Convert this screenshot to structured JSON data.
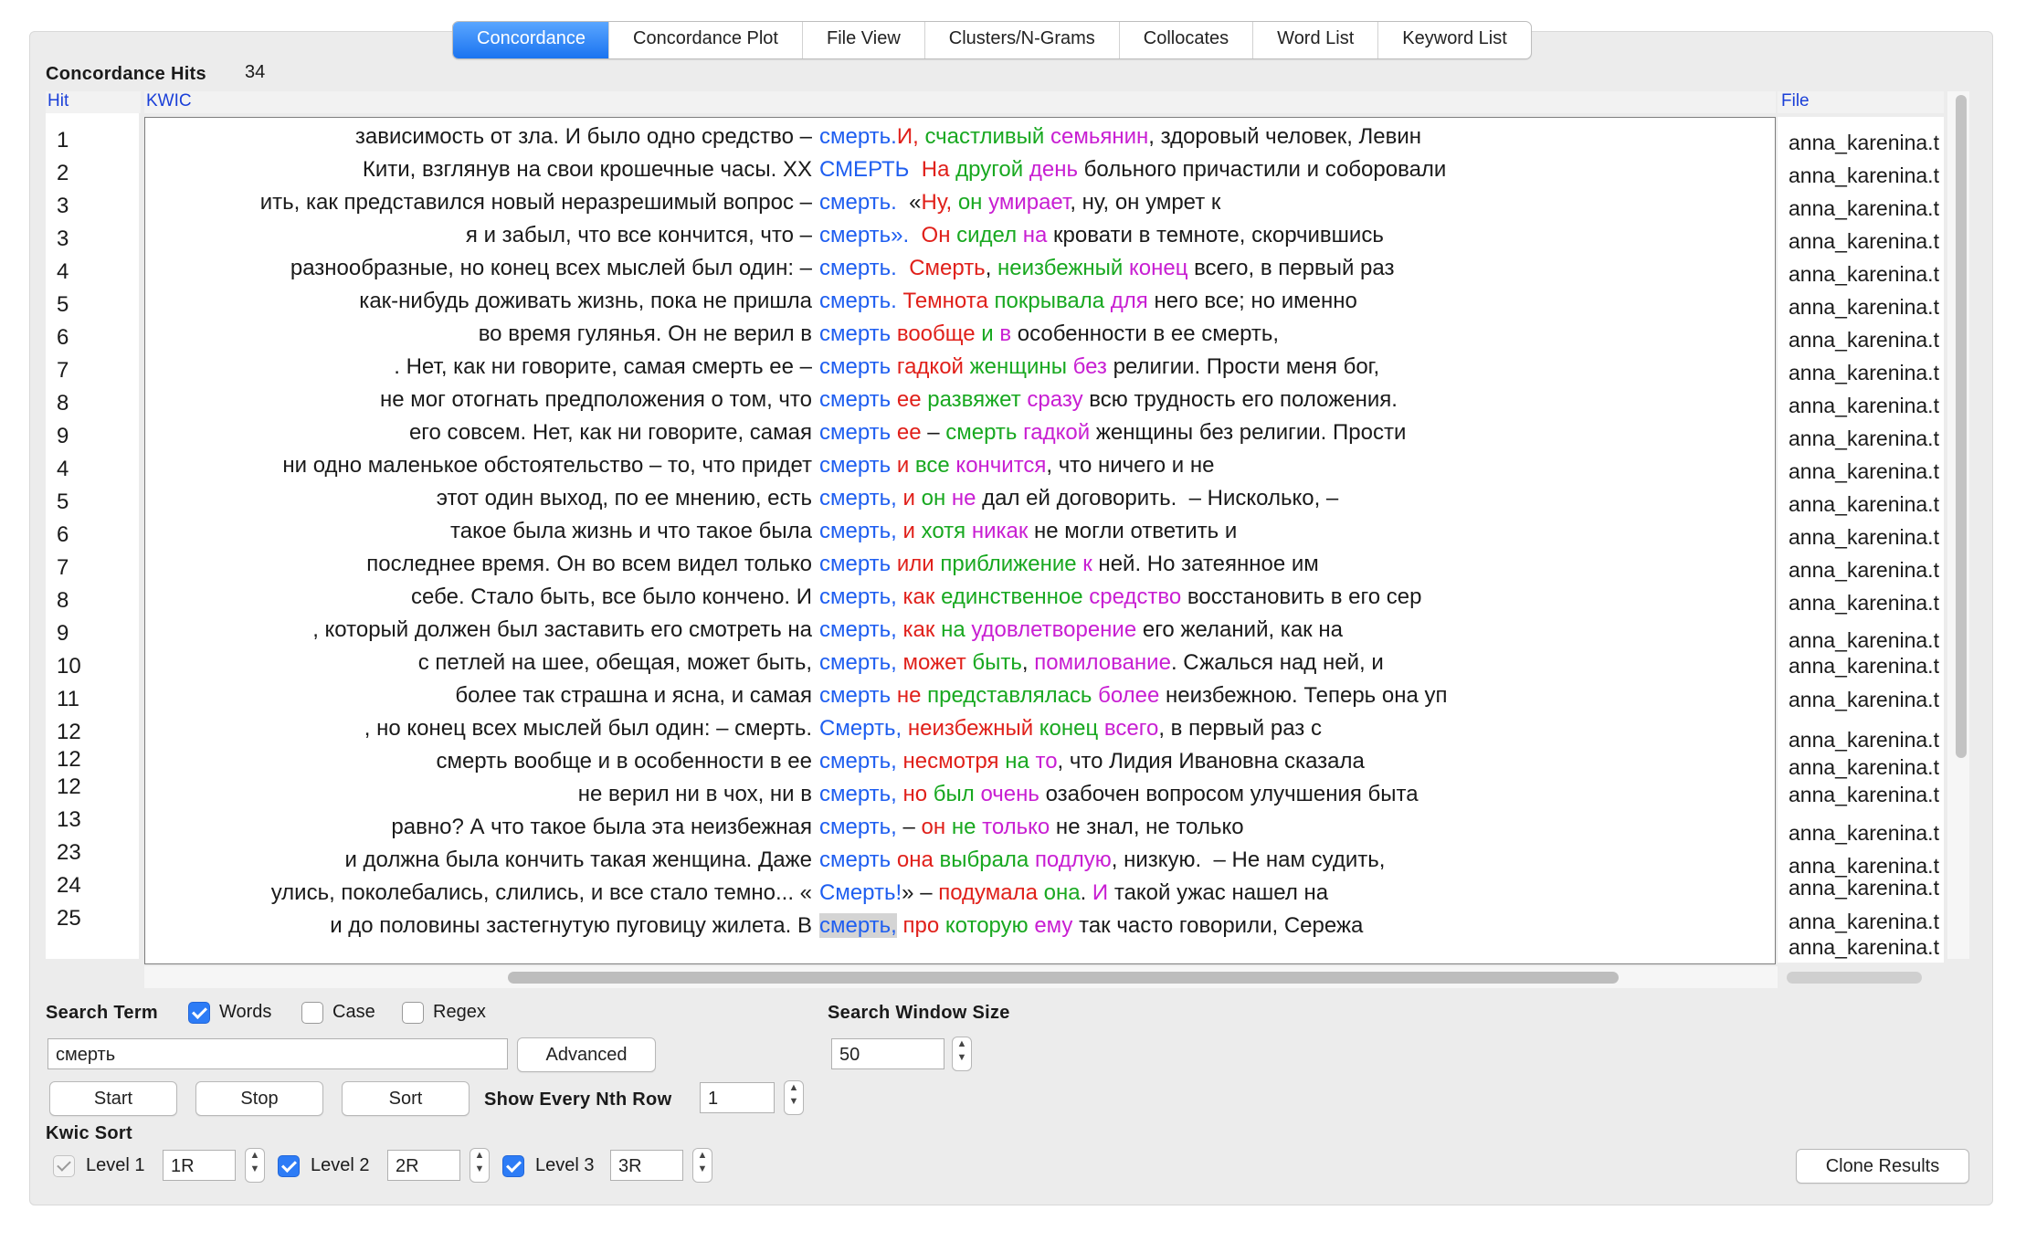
{
  "tabs": [
    {
      "label": "Concordance",
      "active": true
    },
    {
      "label": "Concordance Plot"
    },
    {
      "label": "File View"
    },
    {
      "label": "Clusters/N-Grams"
    },
    {
      "label": "Collocates"
    },
    {
      "label": "Word List"
    },
    {
      "label": "Keyword List"
    }
  ],
  "hits": {
    "label": "Concordance Hits",
    "count": "34"
  },
  "columns": {
    "hit": "Hit",
    "kwic": "KWIC",
    "file": "File"
  },
  "colors": {
    "keyword": "#1e5ef0",
    "sort_level_1": "#e0201a",
    "sort_level_2": "#18a820",
    "sort_level_3": "#c81ed2",
    "tab_active": "#1a73f0"
  },
  "rows": [
    {
      "hit": "1",
      "left": "зависимость от зла. И было одно средство –",
      "kw": "смерть.",
      "right": [
        [
          "И,",
          "c1"
        ],
        [
          " "
        ],
        [
          "счастливый",
          "c2"
        ],
        [
          " "
        ],
        [
          "семьянин",
          "c3"
        ],
        [
          ", здоровый человек, Левин"
        ]
      ],
      "file": "anna_karenina.t"
    },
    {
      "hit": "2",
      "left": "Кити, взглянув на свои крошечные часы.       XX",
      "kw": "СМЕРТЬ",
      "right": [
        [
          "  "
        ],
        [
          "На",
          "c1"
        ],
        [
          " "
        ],
        [
          "другой",
          "c2"
        ],
        [
          " "
        ],
        [
          "день",
          "c3"
        ],
        [
          " больного причастили и соборовали"
        ]
      ],
      "file": "anna_karenina.t"
    },
    {
      "hit": "3",
      "left": "ить, как представился новый неразрешимый вопрос –",
      "kw": "смерть.",
      "right": [
        [
          "  «"
        ],
        [
          "Ну,",
          "c1"
        ],
        [
          " "
        ],
        [
          "он",
          "c2"
        ],
        [
          " "
        ],
        [
          "умирает",
          "c3"
        ],
        [
          ", ну, он умрет к"
        ]
      ],
      "file": "anna_karenina.t"
    },
    {
      "hit": "3",
      "left": "я и забыл, что все кончится, что –",
      "kw": "смерть».",
      "right": [
        [
          "  "
        ],
        [
          "Он",
          "c1"
        ],
        [
          " "
        ],
        [
          "сидел",
          "c2"
        ],
        [
          " "
        ],
        [
          "на",
          "c3"
        ],
        [
          " кровати в темноте, скорчившись"
        ]
      ],
      "file": "anna_karenina.t"
    },
    {
      "hit": "4",
      "left": "разнообразные, но конец всех мыслей был один: –",
      "kw": "смерть.",
      "right": [
        [
          "  "
        ],
        [
          "Смерть",
          "c1"
        ],
        [
          ", "
        ],
        [
          "неизбежный",
          "c2"
        ],
        [
          " "
        ],
        [
          "конец",
          "c3"
        ],
        [
          " всего, в первый раз"
        ]
      ],
      "file": "anna_karenina.t"
    },
    {
      "hit": "5",
      "left": "как-нибудь доживать жизнь, пока не пришла",
      "kw": "смерть.",
      "right": [
        [
          " "
        ],
        [
          "Темнота",
          "c1"
        ],
        [
          " "
        ],
        [
          "покрывала",
          "c2"
        ],
        [
          " "
        ],
        [
          "для",
          "c3"
        ],
        [
          " него все; но именно"
        ]
      ],
      "file": "anna_karenina.t"
    },
    {
      "hit": "6",
      "left": "во время гулянья. Он не верил в",
      "kw": "смерть",
      "right": [
        [
          " "
        ],
        [
          "вообще",
          "c1"
        ],
        [
          " "
        ],
        [
          "и",
          "c2"
        ],
        [
          " "
        ],
        [
          "в",
          "c3"
        ],
        [
          " особенности в ее смерть,"
        ]
      ],
      "file": "anna_karenina.t"
    },
    {
      "hit": "7",
      "left": ". Нет, как ни говорите, самая смерть ее –",
      "kw": "смерть",
      "right": [
        [
          " "
        ],
        [
          "гадкой",
          "c1"
        ],
        [
          " "
        ],
        [
          "женщины",
          "c2"
        ],
        [
          " "
        ],
        [
          "без",
          "c3"
        ],
        [
          " религии. Прости меня бог,"
        ]
      ],
      "file": "anna_karenina.t"
    },
    {
      "hit": "8",
      "left": "не мог отогнать предположения о том, что",
      "kw": "смерть",
      "right": [
        [
          " "
        ],
        [
          "ее",
          "c1"
        ],
        [
          " "
        ],
        [
          "развяжет",
          "c2"
        ],
        [
          " "
        ],
        [
          "сразу",
          "c3"
        ],
        [
          " всю трудность его положения."
        ]
      ],
      "file": "anna_karenina.t"
    },
    {
      "hit": "9",
      "left": "его совсем. Нет, как ни говорите, самая",
      "kw": "смерть",
      "right": [
        [
          " "
        ],
        [
          "ее",
          "c1"
        ],
        [
          " – "
        ],
        [
          "смерть",
          "c2"
        ],
        [
          " "
        ],
        [
          "гадкой",
          "c3"
        ],
        [
          " женщины без религии. Прости"
        ]
      ],
      "file": "anna_karenina.t"
    },
    {
      "hit": "4",
      "left": "ни одно маленькое обстоятельство – то, что придет",
      "kw": "смерть",
      "right": [
        [
          " "
        ],
        [
          "и",
          "c1"
        ],
        [
          " "
        ],
        [
          "все",
          "c2"
        ],
        [
          " "
        ],
        [
          "кончится",
          "c3"
        ],
        [
          ", что ничего и не"
        ]
      ],
      "file": "anna_karenina.t"
    },
    {
      "hit": "5",
      "left": "этот один выход, по ее мнению, есть",
      "kw": "смерть,",
      "right": [
        [
          " "
        ],
        [
          "и",
          "c1"
        ],
        [
          " "
        ],
        [
          "он",
          "c2"
        ],
        [
          " "
        ],
        [
          "не",
          "c3"
        ],
        [
          " дал ей договорить.  – Нисколько, –"
        ]
      ],
      "file": "anna_karenina.t"
    },
    {
      "hit": "6",
      "left": "такое была жизнь и что такое была",
      "kw": "смерть,",
      "right": [
        [
          " "
        ],
        [
          "и",
          "c1"
        ],
        [
          " "
        ],
        [
          "хотя",
          "c2"
        ],
        [
          " "
        ],
        [
          "никак",
          "c3"
        ],
        [
          " не могли ответить и"
        ]
      ],
      "file": "anna_karenina.t"
    },
    {
      "hit": "7",
      "left": "последнее время. Он во всем видел только",
      "kw": "смерть",
      "right": [
        [
          " "
        ],
        [
          "или",
          "c1"
        ],
        [
          " "
        ],
        [
          "приближение",
          "c2"
        ],
        [
          " "
        ],
        [
          "к",
          "c3"
        ],
        [
          " ней. Но затеянное им"
        ]
      ],
      "file": "anna_karenina.t"
    },
    {
      "hit": "8",
      "left": "себе. Стало быть, все было кончено.  И",
      "kw": "смерть,",
      "right": [
        [
          " "
        ],
        [
          "как",
          "c1"
        ],
        [
          " "
        ],
        [
          "единственное",
          "c2"
        ],
        [
          " "
        ],
        [
          "средство",
          "c3"
        ],
        [
          " восстановить в его сер"
        ]
      ],
      "file": "anna_karenina.t"
    },
    {
      "hit": "9",
      "left": ", который должен был заставить его смотреть на",
      "kw": "смерть,",
      "right": [
        [
          " "
        ],
        [
          "как",
          "c1"
        ],
        [
          " "
        ],
        [
          "на",
          "c2"
        ],
        [
          " "
        ],
        [
          "удовлетворение",
          "c3"
        ],
        [
          " его желаний, как на"
        ]
      ],
      "file": "anna_karenina.t"
    },
    {
      "hit": "10",
      "left": "с петлей на шее, обещая, может быть,",
      "kw": "смерть,",
      "right": [
        [
          " "
        ],
        [
          "может",
          "c1"
        ],
        [
          " "
        ],
        [
          "быть",
          "c2"
        ],
        [
          ", "
        ],
        [
          "помилование",
          "c3"
        ],
        [
          ". Сжалься над ней, и"
        ]
      ],
      "file": "anna_karenina.t"
    },
    {
      "hit": "11",
      "left": "более так страшна и ясна, и самая",
      "kw": "смерть",
      "right": [
        [
          " "
        ],
        [
          "не",
          "c1"
        ],
        [
          " "
        ],
        [
          "представлялась",
          "c2"
        ],
        [
          " "
        ],
        [
          "более",
          "c3"
        ],
        [
          " неизбежною. Теперь она уп"
        ]
      ],
      "file": "anna_karenina.t"
    },
    {
      "hit": "12",
      "left": ", но конец всех мыслей был один: – смерть.",
      "kw": "Смерть,",
      "right": [
        [
          " "
        ],
        [
          "неизбежный",
          "c1"
        ],
        [
          " "
        ],
        [
          "конец",
          "c2"
        ],
        [
          " "
        ],
        [
          "всего",
          "c3"
        ],
        [
          ", в первый раз с"
        ]
      ],
      "file": "anna_karenina.t"
    },
    {
      "hit": "12",
      "left": "смерть вообще и в особенности в ее",
      "kw": "смерть,",
      "right": [
        [
          " "
        ],
        [
          "несмотря",
          "c1"
        ],
        [
          " "
        ],
        [
          "на",
          "c2"
        ],
        [
          " "
        ],
        [
          "то",
          "c3"
        ],
        [
          ", что Лидия Ивановна сказала"
        ]
      ],
      "file": "anna_karenina.t"
    },
    {
      "hit": "12",
      "left": "не верил ни в чох, ни в",
      "kw": "смерть,",
      "right": [
        [
          " "
        ],
        [
          "но",
          "c1"
        ],
        [
          " "
        ],
        [
          "был",
          "c2"
        ],
        [
          " "
        ],
        [
          "очень",
          "c3"
        ],
        [
          " озабочен вопросом улучшения быта"
        ]
      ],
      "file": "anna_karenina.t"
    },
    {
      "hit": "13",
      "left": "равно? А что такое была эта неизбежная",
      "kw": "смерть,",
      "right": [
        [
          " – "
        ],
        [
          "он",
          "c1"
        ],
        [
          " "
        ],
        [
          "не",
          "c2"
        ],
        [
          " "
        ],
        [
          "только",
          "c3"
        ],
        [
          " не знал, не только"
        ]
      ],
      "file": "anna_karenina.t"
    },
    {
      "hit": "23",
      "left": "и должна была кончить такая женщина. Даже",
      "kw": "смерть",
      "right": [
        [
          " "
        ],
        [
          "она",
          "c1"
        ],
        [
          " "
        ],
        [
          "выбрала",
          "c2"
        ],
        [
          " "
        ],
        [
          "подлую",
          "c3"
        ],
        [
          ", низкую.  – Не нам судить,"
        ]
      ],
      "file": "anna_karenina.t"
    },
    {
      "hit": "24",
      "left": "улись, поколебались, слились, и все стало темно... «",
      "kw": "Смерть!",
      "right": [
        [
          "» – "
        ],
        [
          "подумала",
          "c1"
        ],
        [
          " "
        ],
        [
          "она",
          "c2"
        ],
        [
          ". "
        ],
        [
          "И",
          "c3"
        ],
        [
          " такой ужас нашел на"
        ]
      ],
      "file": "anna_karenina.t"
    },
    {
      "hit": "25",
      "left": "и до половины застегнутую пуговицу жилета.  В",
      "kw": "смерть,",
      "kw_selected": true,
      "right": [
        [
          " "
        ],
        [
          "про",
          "c1"
        ],
        [
          " "
        ],
        [
          "которую",
          "c2"
        ],
        [
          " "
        ],
        [
          "ему",
          "c3"
        ],
        [
          " так часто говорили, Сережа"
        ]
      ],
      "file": "anna_karenina.t"
    }
  ],
  "extra_file_entries": [
    "anna_karenina.t",
    "anna_karenina.t"
  ],
  "search": {
    "term_label": "Search Term",
    "words_label": "Words",
    "words_checked": true,
    "case_label": "Case",
    "case_checked": false,
    "regex_label": "Regex",
    "regex_checked": false,
    "value": "смерть",
    "advanced_label": "Advanced",
    "window_label": "Search Window Size",
    "window_value": "50"
  },
  "buttons": {
    "start": "Start",
    "stop": "Stop",
    "sort": "Sort",
    "clone": "Clone Results"
  },
  "nth_row": {
    "label": "Show Every Nth Row",
    "value": "1"
  },
  "kwic_sort": {
    "label": "Kwic Sort",
    "levels": [
      {
        "label": "Level 1",
        "value": "1R",
        "checked": false
      },
      {
        "label": "Level 2",
        "value": "2R",
        "checked": true
      },
      {
        "label": "Level 3",
        "value": "3R",
        "checked": true
      }
    ]
  }
}
